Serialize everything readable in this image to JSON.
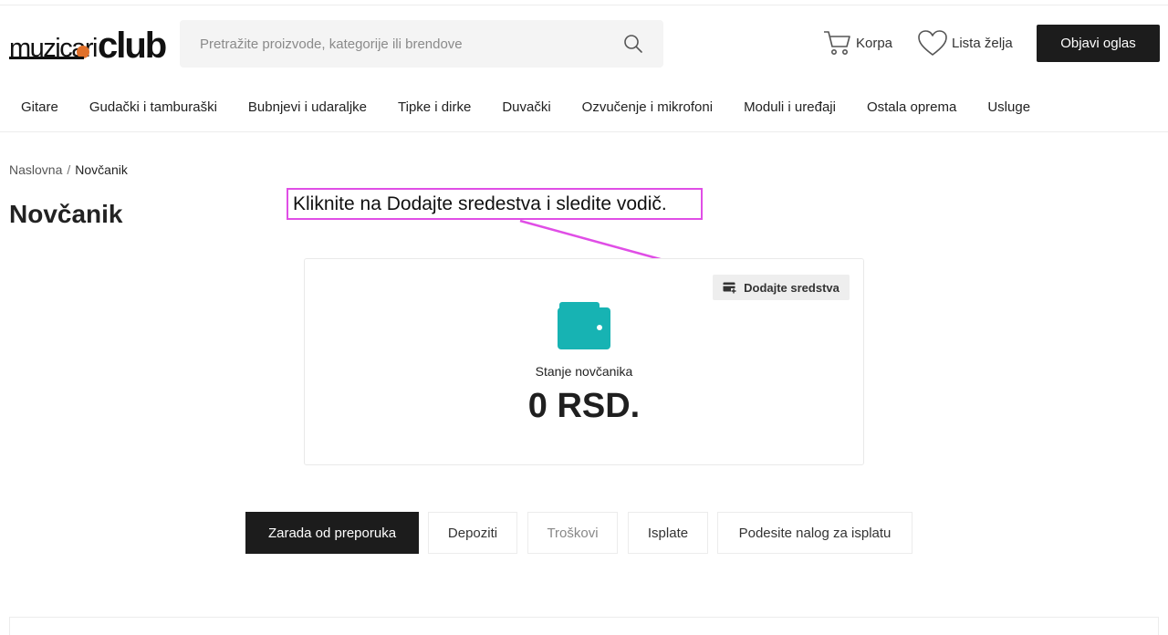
{
  "header": {
    "logo_text_1": "muzicari",
    "logo_text_2": "club",
    "search_placeholder": "Pretražite proizvode, kategorije ili brendove",
    "cart_label": "Korpa",
    "wishlist_label": "Lista želja",
    "post_ad_label": "Objavi oglas"
  },
  "nav": {
    "items": [
      "Gitare",
      "Gudački i tamburaški",
      "Bubnjevi i udaraljke",
      "Tipke i dirke",
      "Duvački",
      "Ozvučenje i mikrofoni",
      "Moduli i uređaji",
      "Ostala oprema",
      "Usluge"
    ]
  },
  "breadcrumb": {
    "home": "Naslovna",
    "separator": "/",
    "current": "Novčanik"
  },
  "page": {
    "title": "Novčanik"
  },
  "annotation": {
    "text": "Kliknite na Dodajte sredestva i sledite vodič.",
    "color": "#e04ee6"
  },
  "wallet": {
    "add_funds_label": "Dodajte sredstva",
    "balance_label": "Stanje novčanika",
    "balance_value": "0 RSD.",
    "icon_color": "#17b3b3"
  },
  "tabs": [
    {
      "label": "Zarada od preporuka",
      "active": true
    },
    {
      "label": "Depoziti",
      "active": false
    },
    {
      "label": "Troškovi",
      "active": false
    },
    {
      "label": "Isplate",
      "active": false
    },
    {
      "label": "Podesite nalog za isplatu",
      "active": false
    }
  ]
}
